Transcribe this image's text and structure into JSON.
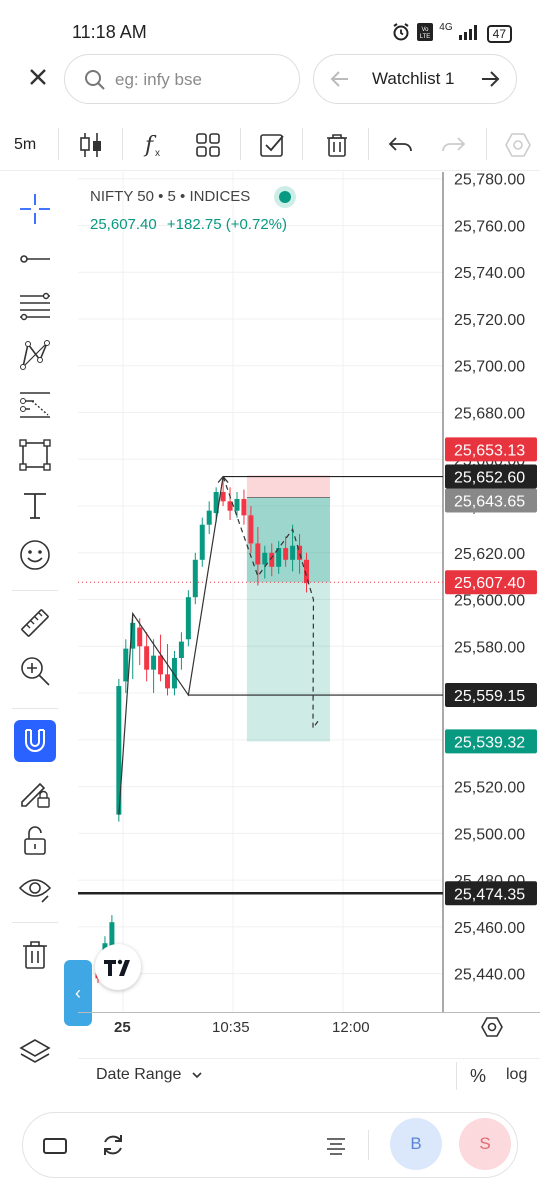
{
  "status": {
    "time": "11:18 AM",
    "network": "4G",
    "battery": "47"
  },
  "search": {
    "placeholder": "eg: infy bse"
  },
  "watchlist": {
    "label": "Watchlist 1"
  },
  "toolbar": {
    "timeframe": "5m"
  },
  "legend": {
    "symbol": "NIFTY 50",
    "interval": "5",
    "exchange": "INDICES",
    "price": "25,607.40",
    "change": "+182.75 (+0.72%)"
  },
  "price_axis": {
    "ticks": [
      "25,780.00",
      "25,760.00",
      "25,740.00",
      "25,720.00",
      "25,700.00",
      "25,680.00",
      "25,660.00",
      "25,640.00",
      "25,620.00",
      "25,600.00",
      "25,580.00",
      "25,560.00",
      "25,540.00",
      "25,520.00",
      "25,500.00",
      "25,480.00",
      "25,460.00",
      "25,440.00"
    ],
    "tags": [
      {
        "label": "25,653.13",
        "color": "#e8343f"
      },
      {
        "label": "25,652.60",
        "color": "#222222"
      },
      {
        "label": "25,643.65",
        "color": "#888888"
      },
      {
        "label": "25,607.40",
        "color": "#e8343f"
      },
      {
        "label": "25,559.15",
        "color": "#222222"
      },
      {
        "label": "25,539.32",
        "color": "#089981"
      },
      {
        "label": "25,474.35",
        "color": "#222222"
      }
    ]
  },
  "time_axis": {
    "labels": [
      "25",
      "10:35",
      "12:00"
    ]
  },
  "bottom": {
    "date_range": "Date Range",
    "percent": "%",
    "log": "log",
    "buy": "B",
    "sell": "S"
  },
  "colors": {
    "up": "#089981",
    "down": "#f23645",
    "accent": "#2962ff"
  },
  "chart_data": {
    "type": "candlestick",
    "title": "",
    "ylim": [
      25430,
      25785
    ],
    "candles": [
      {
        "o": 25440,
        "h": 25442,
        "l": 25436,
        "c": 25438
      },
      {
        "o": 25448,
        "h": 25456,
        "l": 25444,
        "c": 25453
      },
      {
        "o": 25452,
        "h": 25465,
        "l": 25448,
        "c": 25462
      },
      {
        "o": 25508,
        "h": 25566,
        "l": 25505,
        "c": 25563
      },
      {
        "o": 25565,
        "h": 25583,
        "l": 25560,
        "c": 25579
      },
      {
        "o": 25579,
        "h": 25594,
        "l": 25566,
        "c": 25590
      },
      {
        "o": 25588,
        "h": 25592,
        "l": 25572,
        "c": 25580
      },
      {
        "o": 25580,
        "h": 25586,
        "l": 25565,
        "c": 25570
      },
      {
        "o": 25570,
        "h": 25583,
        "l": 25560,
        "c": 25576
      },
      {
        "o": 25576,
        "h": 25585,
        "l": 25565,
        "c": 25568
      },
      {
        "o": 25568,
        "h": 25581,
        "l": 25559,
        "c": 25562
      },
      {
        "o": 25562,
        "h": 25578,
        "l": 25559,
        "c": 25575
      },
      {
        "o": 25575,
        "h": 25586,
        "l": 25570,
        "c": 25582
      },
      {
        "o": 25583,
        "h": 25604,
        "l": 25580,
        "c": 25601
      },
      {
        "o": 25601,
        "h": 25620,
        "l": 25598,
        "c": 25617
      },
      {
        "o": 25617,
        "h": 25635,
        "l": 25614,
        "c": 25632
      },
      {
        "o": 25632,
        "h": 25642,
        "l": 25628,
        "c": 25638
      },
      {
        "o": 25637,
        "h": 25648,
        "l": 25633,
        "c": 25646
      },
      {
        "o": 25646,
        "h": 25652,
        "l": 25640,
        "c": 25642
      },
      {
        "o": 25642,
        "h": 25648,
        "l": 25634,
        "c": 25638
      },
      {
        "o": 25638,
        "h": 25646,
        "l": 25635,
        "c": 25643
      },
      {
        "o": 25643,
        "h": 25647,
        "l": 25632,
        "c": 25636
      },
      {
        "o": 25636,
        "h": 25640,
        "l": 25620,
        "c": 25624
      },
      {
        "o": 25624,
        "h": 25631,
        "l": 25606,
        "c": 25615
      },
      {
        "o": 25615,
        "h": 25623,
        "l": 25609,
        "c": 25620
      },
      {
        "o": 25620,
        "h": 25624,
        "l": 25610,
        "c": 25614
      },
      {
        "o": 25614,
        "h": 25625,
        "l": 25611,
        "c": 25622
      },
      {
        "o": 25622,
        "h": 25627,
        "l": 25614,
        "c": 25617
      },
      {
        "o": 25617,
        "h": 25632,
        "l": 25612,
        "c": 25623
      },
      {
        "o": 25623,
        "h": 25628,
        "l": 25611,
        "c": 25617
      },
      {
        "o": 25617,
        "h": 25620,
        "l": 25603,
        "c": 25607
      }
    ],
    "hlines": [
      25652.6,
      25559.15,
      25474.35
    ],
    "position": {
      "entry": 25643.65,
      "stop": 25653.13,
      "target": 25539.32
    }
  }
}
